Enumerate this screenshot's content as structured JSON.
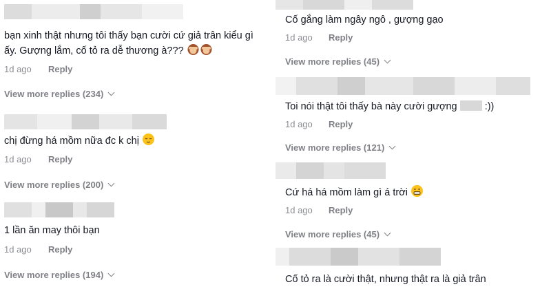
{
  "left": {
    "comments": [
      {
        "line1": "bạn xinh thật nhưng tôi thấy bạn cười cứ giả trân kiểu gì",
        "line2": "ấy. Gượng lắm, cố tỏ ra dễ thương à???",
        "emojis": [
          "see-no-evil-monkey",
          "see-no-evil-monkey"
        ],
        "time": "1d ago",
        "reply": "Reply",
        "more": "View more replies (234)"
      },
      {
        "line1": "chị đừng há mồm nữa đc k chị",
        "emojis": [
          "relieved-face"
        ],
        "time": "1d ago",
        "reply": "Reply",
        "more": "View more replies (200)"
      },
      {
        "line1": "1 lần ăn may thôi bạn",
        "time": "1d ago",
        "reply": "Reply",
        "more": "View more replies (194)"
      }
    ]
  },
  "right": {
    "comments": [
      {
        "line1": "Cố gắng làm ngây ngô , gượng gạo",
        "time": "1d ago",
        "reply": "Reply",
        "more": "View more replies (45)"
      },
      {
        "line1_a": "Toi nói thật tôi thấy bà này cười gượng",
        "line1_b": ":))",
        "time": "1d ago",
        "reply": "Reply",
        "more": "View more replies (121)"
      },
      {
        "line1": "Cứ há há mồm làm gì á trời",
        "emojis": [
          "grimacing-face"
        ],
        "time": "1d ago",
        "reply": "Reply",
        "more": "View more replies (45)"
      },
      {
        "line1": "Cố tỏ ra là cười thật, nhưng thật ra là giả trân"
      }
    ]
  },
  "colors": {
    "text": "#161823",
    "meta": "#8a8b91",
    "pixelated": [
      "#e8e8e8",
      "#d0d0d0",
      "#c4c4c4",
      "#dedede"
    ]
  }
}
